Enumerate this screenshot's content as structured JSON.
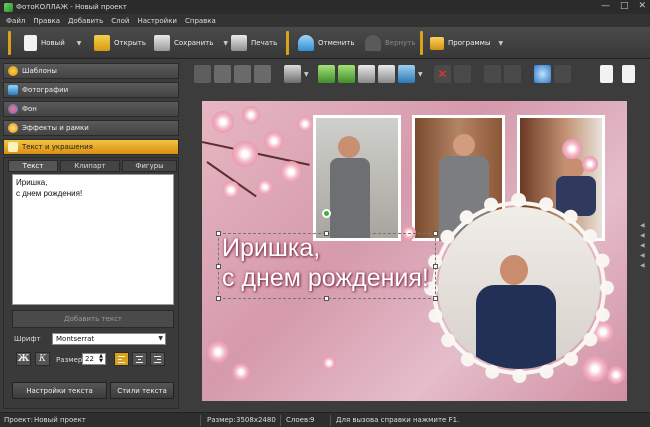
{
  "window": {
    "title": "ФотоКОЛЛАЖ - Новый проект",
    "controls": [
      "—",
      "□",
      "✕"
    ]
  },
  "menu": [
    "Файл",
    "Правка",
    "Добавить",
    "Слой",
    "Настройки",
    "Справка"
  ],
  "toolbar": {
    "new": "Новый",
    "open": "Открыть",
    "save": "Сохранить",
    "print": "Печать",
    "undo": "Отменить",
    "redo": "Вернуть",
    "programs": "Программы"
  },
  "sidebar": {
    "sections": [
      "Шаблоны",
      "Фотографии",
      "Фон",
      "Эффекты и рамки",
      "Текст и украшения"
    ],
    "active_section": "Текст и украшения",
    "tabs": [
      "Текст",
      "Клипарт",
      "Фигуры"
    ],
    "active_tab": "Текст",
    "text_value": "Иришка,\nс днем рождения!",
    "add_text_label": "Добавить текст",
    "font_label": "Шрифт",
    "font_value": "Montserrat",
    "bold_label": "Ж",
    "italic_label": "К",
    "size_label": "Размер",
    "size_value": "22",
    "settings_button": "Настройки текста",
    "styles_button": "Стили текста"
  },
  "canvas": {
    "text_line1": "Иришка,",
    "text_line2": "с днем рождения!"
  },
  "status": {
    "project_label": "Проект:",
    "project_name": "Новый проект",
    "size_label": "Размер:",
    "size_value": "3508x2480",
    "layers_label": "Слоев:",
    "layers_value": "9",
    "help": "Для вызова справки нажмите F1."
  },
  "colors": {
    "accent": "#d9a21a",
    "active_section": "#f3c444",
    "canvas_bg": "#e2aebd"
  }
}
